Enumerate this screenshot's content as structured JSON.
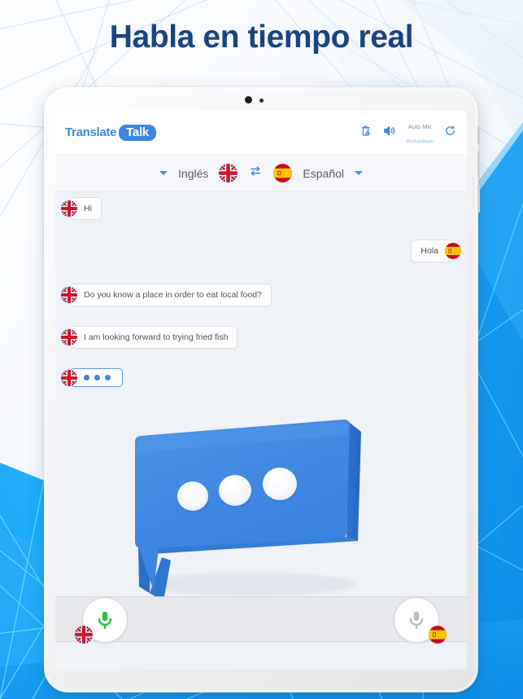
{
  "headline": "Habla en tiempo real",
  "app": {
    "logo": {
      "part1": "Translate",
      "part2": "Talk"
    },
    "header_icons": [
      {
        "name": "history-delete-icon",
        "glyph": "history-delete"
      },
      {
        "name": "speaker-volume-icon",
        "glyph": "speaker"
      },
      {
        "name": "refresh-icon",
        "glyph": "refresh"
      }
    ],
    "auto_mic": {
      "title": "Auto Mic",
      "status": "Deshabilitado"
    },
    "language_bar": {
      "source_language": "Inglés",
      "source_flag": "uk-flag",
      "target_language": "Español",
      "target_flag": "spain-flag",
      "swap_icon": "swap-arrows-icon",
      "left_caret": "chevron-down-icon",
      "right_caret": "chevron-down-icon"
    },
    "messages": [
      {
        "side": "left",
        "flag": "uk-flag",
        "text": "Hi",
        "type": "text"
      },
      {
        "side": "right",
        "flag": "spain-flag",
        "text": "Hola",
        "type": "text"
      },
      {
        "side": "left",
        "flag": "uk-flag",
        "text": "Do you know a place in order to eat local food?",
        "type": "text"
      },
      {
        "side": "left",
        "flag": "uk-flag",
        "text": "I am looking forward to trying fried fish",
        "type": "text"
      },
      {
        "side": "left",
        "flag": "uk-flag",
        "text": "",
        "type": "typing"
      }
    ],
    "illustration": {
      "name": "speech-bubble-3d",
      "dots": 3
    },
    "mic_buttons": [
      {
        "name": "mic-button-english",
        "state": "active",
        "color": "#25c23a",
        "badge_flag": "uk-flag"
      },
      {
        "name": "mic-button-spanish",
        "state": "inactive",
        "color": "#b8bbc0",
        "badge_flag": "spain-flag"
      }
    ]
  },
  "colors": {
    "headline": "#1a4480",
    "brand_blue": "#3a86e0",
    "chat_bg": "#eff2f6",
    "mic_active": "#25c23a",
    "mic_inactive": "#b8bbc0",
    "bg_accent": "#1b9ef5"
  }
}
